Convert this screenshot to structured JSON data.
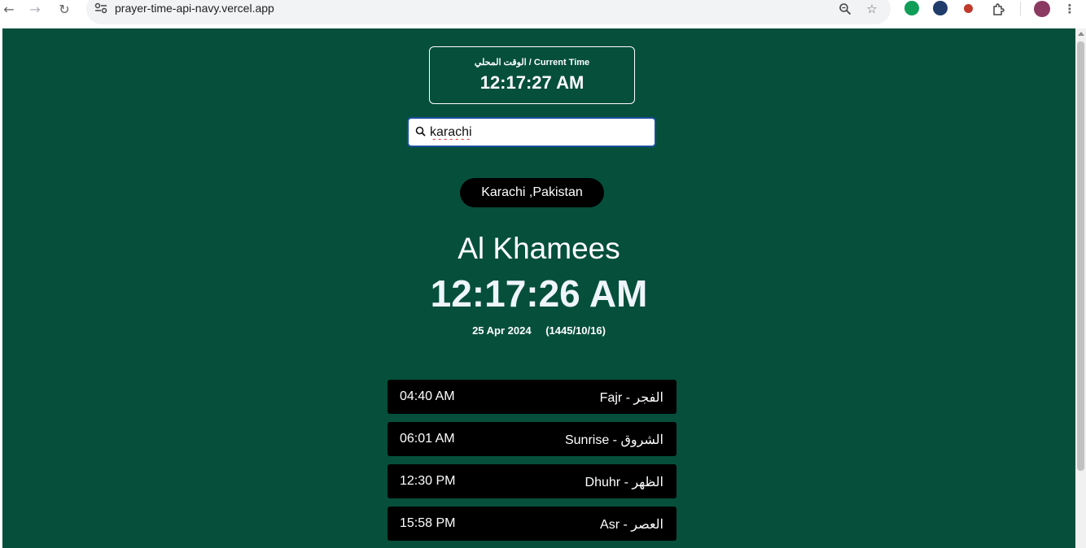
{
  "browser": {
    "url": "prayer-time-api-navy.vercel.app"
  },
  "current_clock": {
    "label": "الوقت المحلي / Current Time",
    "time": "12:17:27 AM"
  },
  "search": {
    "value": "karachi"
  },
  "location": {
    "label": "Karachi ,Pakistan"
  },
  "day": {
    "name": "Al Khamees",
    "time": "12:17:26 AM",
    "gregorian_date": "25 Apr 2024",
    "hijri_date": "(1445/10/16)"
  },
  "prayers": [
    {
      "time": "04:40 AM",
      "name": "Fajr - الفجر"
    },
    {
      "time": "06:01 AM",
      "name": "Sunrise - الشروق"
    },
    {
      "time": "12:30 PM",
      "name": "Dhuhr - الظهر"
    },
    {
      "time": "15:58 PM",
      "name": "Asr - العصر"
    }
  ],
  "colors": {
    "page_background": "#064f3b",
    "card_background": "#000000",
    "text": "#ffffff"
  }
}
